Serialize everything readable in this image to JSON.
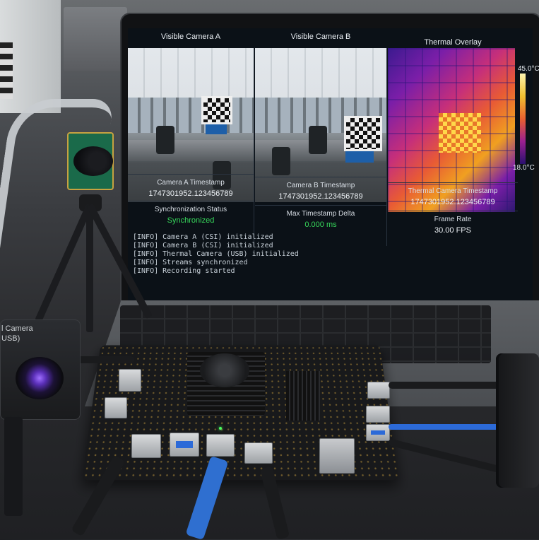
{
  "screen": {
    "panel_a_title": "Visible Camera A",
    "panel_b_title": "Visible Camera B",
    "panel_thermal_title": "Thermal Overlay",
    "thermal_scale_max": "45.0°C",
    "thermal_scale_min": "18.0°C",
    "camera_a_timestamp_label": "Camera A Timestamp",
    "camera_a_timestamp_value": "1747301952.123456789",
    "camera_b_timestamp_label": "Camera B Timestamp",
    "camera_b_timestamp_value": "1747301952.123456789",
    "thermal_timestamp_label": "Thermal Camera Timestamp",
    "thermal_timestamp_value": "1747301952.123456789",
    "sync_status_label": "Synchronization Status",
    "sync_status_value": "Synchronized",
    "max_delta_label": "Max Timestamp Delta",
    "max_delta_value": "0.000 ms",
    "frame_rate_label": "Frame Rate",
    "frame_rate_value": "30.00 FPS",
    "log_lines": [
      "[INFO] Camera A (CSI) initialized",
      "[INFO] Camera B (CSI) initialized",
      "[INFO] Thermal Camera (USB) initialized",
      "[INFO] Streams synchronized",
      "[INFO] Recording started"
    ]
  },
  "thermal_camera_device": {
    "label_line1": "l Camera",
    "label_line2": "USB)"
  },
  "colors": {
    "status_green": "#36d65a",
    "screen_bg": "#0b1117",
    "thermal_hot": "#f0c030",
    "thermal_cold": "#2a1070"
  }
}
